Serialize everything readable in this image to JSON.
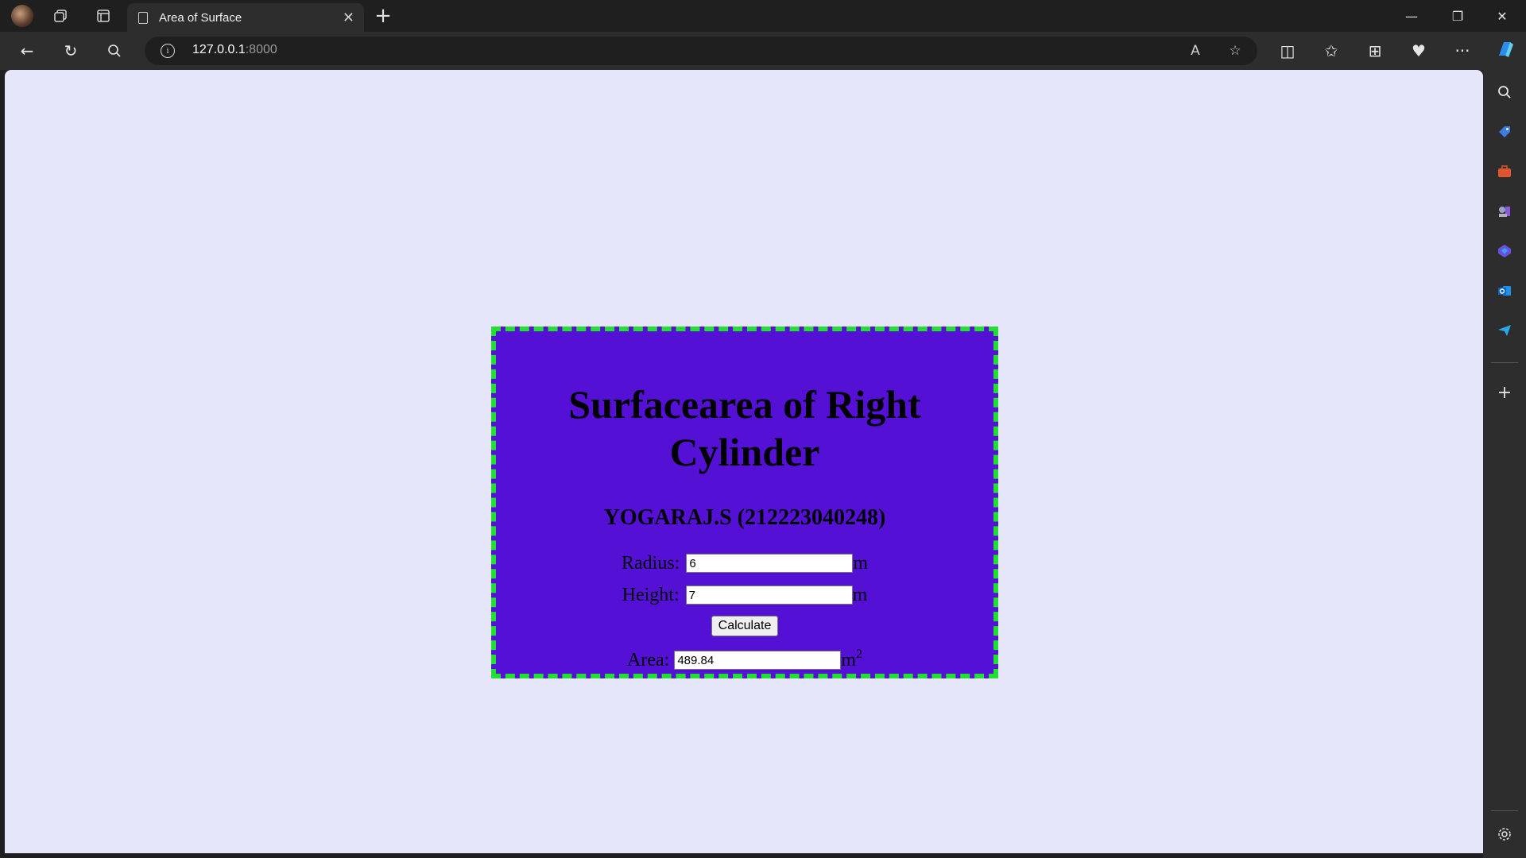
{
  "browser": {
    "tab_title": "Area of Surface",
    "url_host": "127.0.0.1",
    "url_port": ":8000",
    "icons": {
      "new_tab": "+",
      "close": "✕",
      "minimize": "—",
      "restore": "❐",
      "back": "←",
      "refresh": "↻",
      "search": "⌕",
      "read_aloud": "A",
      "favorite": "☆",
      "split": "◫",
      "favorites": "✩",
      "collections": "⊞",
      "health": "♥",
      "more": "···"
    }
  },
  "page": {
    "heading": "Surfacearea of Right Cylinder",
    "author": "YOGARAJ.S (212223040248)",
    "radius_label": "Radius:",
    "radius_value": "6",
    "radius_unit": "m",
    "height_label": "Height:",
    "height_value": "7",
    "height_unit": "m",
    "calculate_label": "Calculate",
    "area_label": "Area:",
    "area_value": "489.84",
    "area_unit": "m",
    "area_unit_exp": "2"
  },
  "colors": {
    "page_bg": "#e6e6fa",
    "card_bg": "#5510d6",
    "card_border": "#21e031"
  }
}
